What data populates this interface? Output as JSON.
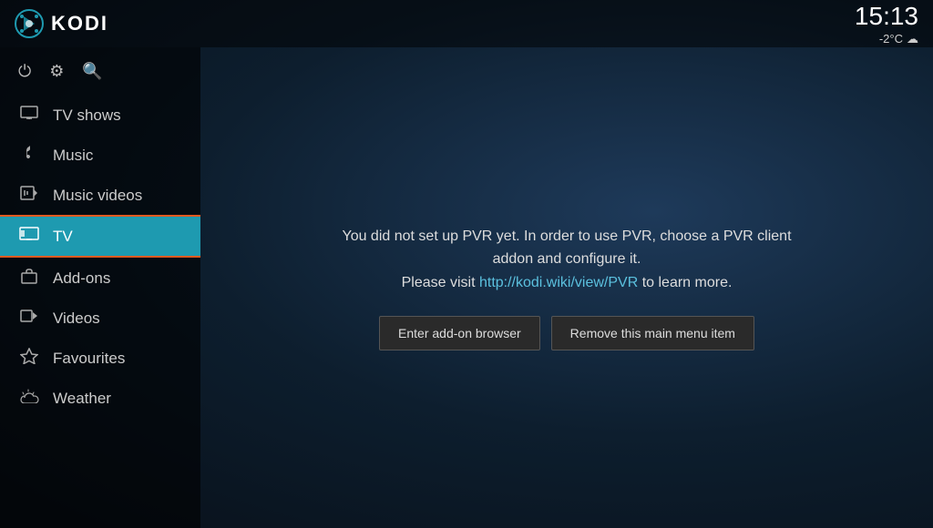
{
  "header": {
    "app_name": "KODI",
    "clock": "15:13",
    "weather": "-2°C",
    "weather_icon": "☁"
  },
  "sidebar": {
    "icons": [
      {
        "name": "power-icon",
        "symbol": "⏻"
      },
      {
        "name": "settings-icon",
        "symbol": "⚙"
      },
      {
        "name": "search-icon",
        "symbol": "🔍"
      }
    ],
    "items": [
      {
        "label": "TV shows",
        "icon": "🖥",
        "name": "tv-shows",
        "active": false
      },
      {
        "label": "Music",
        "icon": "🎧",
        "name": "music",
        "active": false
      },
      {
        "label": "Music videos",
        "icon": "🎬",
        "name": "music-videos",
        "active": false
      },
      {
        "label": "TV",
        "icon": "📺",
        "name": "tv",
        "active": true
      },
      {
        "label": "Add-ons",
        "icon": "📦",
        "name": "add-ons",
        "active": false
      },
      {
        "label": "Videos",
        "icon": "🎞",
        "name": "videos",
        "active": false
      },
      {
        "label": "Favourites",
        "icon": "★",
        "name": "favourites",
        "active": false
      },
      {
        "label": "Weather",
        "icon": "🌤",
        "name": "weather",
        "active": false
      }
    ]
  },
  "pvr": {
    "message_line1": "You did not set up PVR yet. In order to use PVR, choose a PVR client addon and configure it.",
    "message_line2": "Please visit http://kodi.wiki/view/PVR to learn more.",
    "link_text": "http://kodi.wiki/view/PVR",
    "button_addon_browser": "Enter add-on browser",
    "button_remove_item": "Remove this main menu item"
  }
}
